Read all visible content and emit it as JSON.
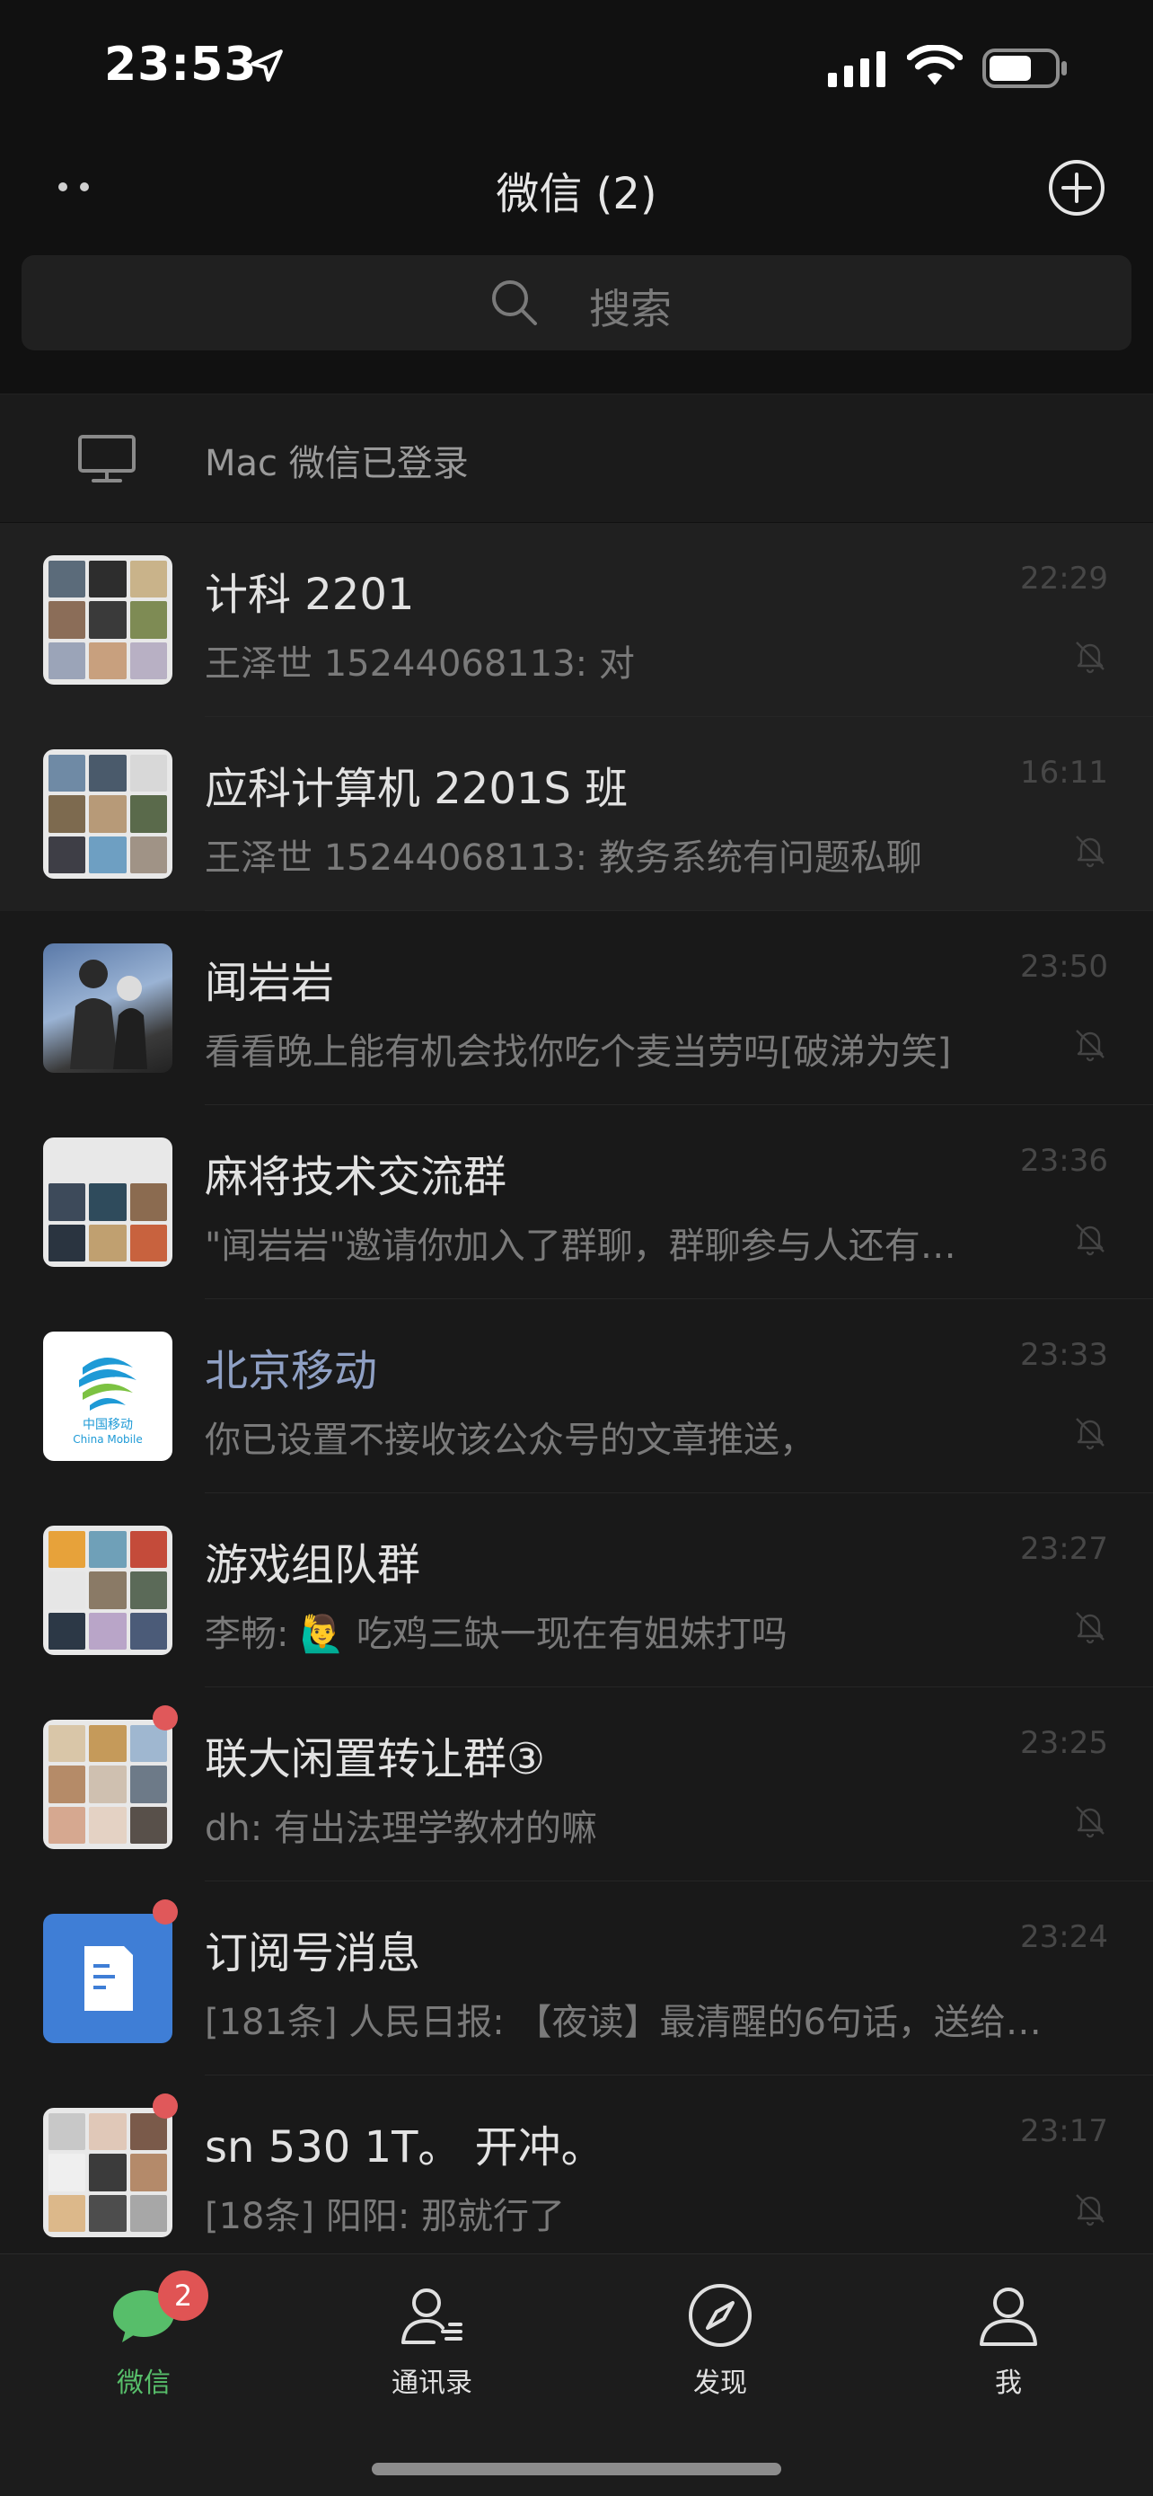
{
  "status_bar": {
    "time": "23:53"
  },
  "nav": {
    "title": "微信 (2)"
  },
  "search": {
    "placeholder": "搜索"
  },
  "mac_banner": {
    "text": "Mac 微信已登录"
  },
  "chats": [
    {
      "name": "计科 2201",
      "preview": "王泽世 15244068113: 对",
      "time": "22:29"
    },
    {
      "name": "应科计算机 2201S 班",
      "preview": "王泽世 15244068113: 教务系统有问题私聊",
      "time": "16:11"
    },
    {
      "name": "闻岩岩",
      "preview": "看看晚上能有机会找你吃个麦当劳吗[破涕为笑]",
      "time": "23:50"
    },
    {
      "name": "麻将技术交流群",
      "preview": "\"闻岩岩\"邀请你加入了群聊，群聊参与人还有…",
      "time": "23:36"
    },
    {
      "name": "北京移动",
      "preview": "你已设置不接收该公众号的文章推送，",
      "time": "23:33"
    },
    {
      "name": "游戏组队群",
      "preview": "李畅: 🙋‍♂️ 吃鸡三缺一现在有姐妹打吗",
      "time": "23:27"
    },
    {
      "name": "联大闲置转让群③",
      "preview": "dh: 有出法理学教材的嘛",
      "time": "23:25"
    },
    {
      "name": "订阅号消息",
      "preview": "[181条] 人民日报: 【夜读】最清醒的6句话，送给…",
      "time": "23:24"
    },
    {
      "name": "sn 530 1T。 开冲。",
      "preview": "[18条] 阳阳: 那就行了",
      "time": "23:17"
    }
  ],
  "tabbar": {
    "chats": {
      "label": "微信",
      "badge": "2"
    },
    "contacts": {
      "label": "通讯录"
    },
    "discover": {
      "label": "发现"
    },
    "me": {
      "label": "我"
    }
  },
  "colors": {
    "accent": "#57be6a",
    "badge": "#e05454",
    "background": "#111111"
  },
  "avatar_logo": {
    "brand_cn": "中国移动",
    "brand_en": "China Mobile"
  }
}
